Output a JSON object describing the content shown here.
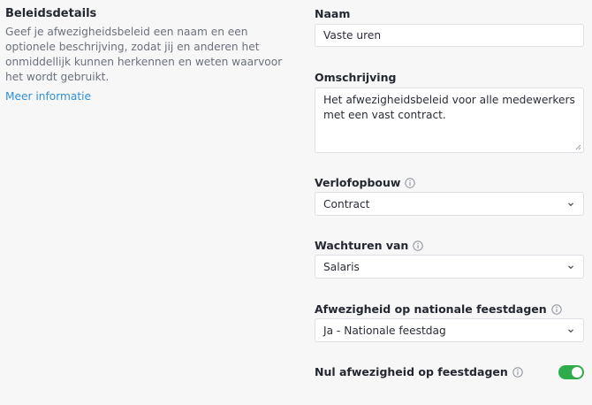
{
  "section": {
    "title": "Beleidsdetails",
    "description": "Geef je afwezigheidsbeleid een naam en een optionele beschrijving, zodat jij en anderen het onmiddellijk kunnen herkennen en weten waarvoor het wordt gebruikt.",
    "more_link": "Meer informatie"
  },
  "fields": {
    "name": {
      "label": "Naam",
      "value": "Vaste uren"
    },
    "description": {
      "label": "Omschrijving",
      "value": "Het afwezigheidsbeleid voor alle medewerkers met een vast contract."
    },
    "accrual": {
      "label": "Verlofopbouw",
      "value": "Contract"
    },
    "wait_hours": {
      "label": "Wachturen van",
      "value": "Salaris"
    },
    "holidays": {
      "label": "Afwezigheid op nationale feestdagen",
      "value": "Ja - Nationale feestdag"
    },
    "zero_absence": {
      "label": "Nul afwezigheid op feestdagen",
      "enabled": true
    }
  },
  "colors": {
    "link": "#2f8fd8",
    "toggle_on": "#2eac4a",
    "background": "#f7f7f8"
  },
  "icons": {
    "info": "info-circle-icon",
    "chevron": "chevron-down-icon"
  }
}
